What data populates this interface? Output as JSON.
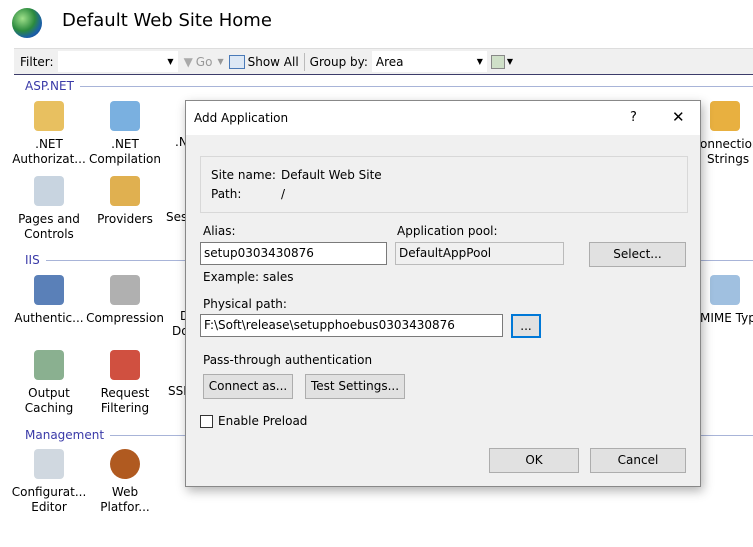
{
  "window": {
    "title": "Default Web Site Home"
  },
  "toolbar": {
    "filter_label": "Filter:",
    "filter_value": "",
    "go_label": "Go",
    "show_all_label": "Show All",
    "group_by_label": "Group by:",
    "group_by_value": "Area"
  },
  "sections": {
    "aspnet": "ASP.NET",
    "iis": "IIS",
    "management": "Management"
  },
  "features": {
    "net_auth": [
      ".NET",
      "Authorizat..."
    ],
    "net_comp": [
      ".NET",
      "Compilation"
    ],
    "pages": [
      "Pages and",
      "Controls"
    ],
    "providers": [
      "Providers"
    ],
    "authentication": [
      "Authentic..."
    ],
    "compression": [
      "Compression"
    ],
    "output": [
      "Output",
      "Caching"
    ],
    "request": [
      "Request",
      "Filtering"
    ],
    "config": [
      "Configurat...",
      "Editor"
    ],
    "webplat": [
      "Web",
      "Platfor..."
    ],
    "conn": [
      "onnection",
      "Strings"
    ],
    "mime": [
      "MIME Types"
    ],
    "partial": {
      "n": ".N",
      "sess": "Sess",
      "d1": "D",
      "d2": "Do",
      "ssl": "SSL"
    }
  },
  "dialog": {
    "title": "Add Application",
    "help": "?",
    "close": "✕",
    "site_name_label": "Site name:",
    "site_name": "Default Web Site",
    "path_label": "Path:",
    "path": "/",
    "alias_label": "Alias:",
    "alias": "setup0303430876",
    "alias_example": "Example: sales",
    "pool_label": "Application pool:",
    "pool": "DefaultAppPool",
    "select_btn": "Select...",
    "physical_label": "Physical path:",
    "physical": "F:\\Soft\\release\\setupphoebus0303430876",
    "browse_btn": "...",
    "passthrough_label": "Pass-through authentication",
    "connect_btn": "Connect as...",
    "test_btn": "Test Settings...",
    "preload_label": "Enable Preload",
    "preload_checked": false,
    "ok": "OK",
    "cancel": "Cancel"
  }
}
